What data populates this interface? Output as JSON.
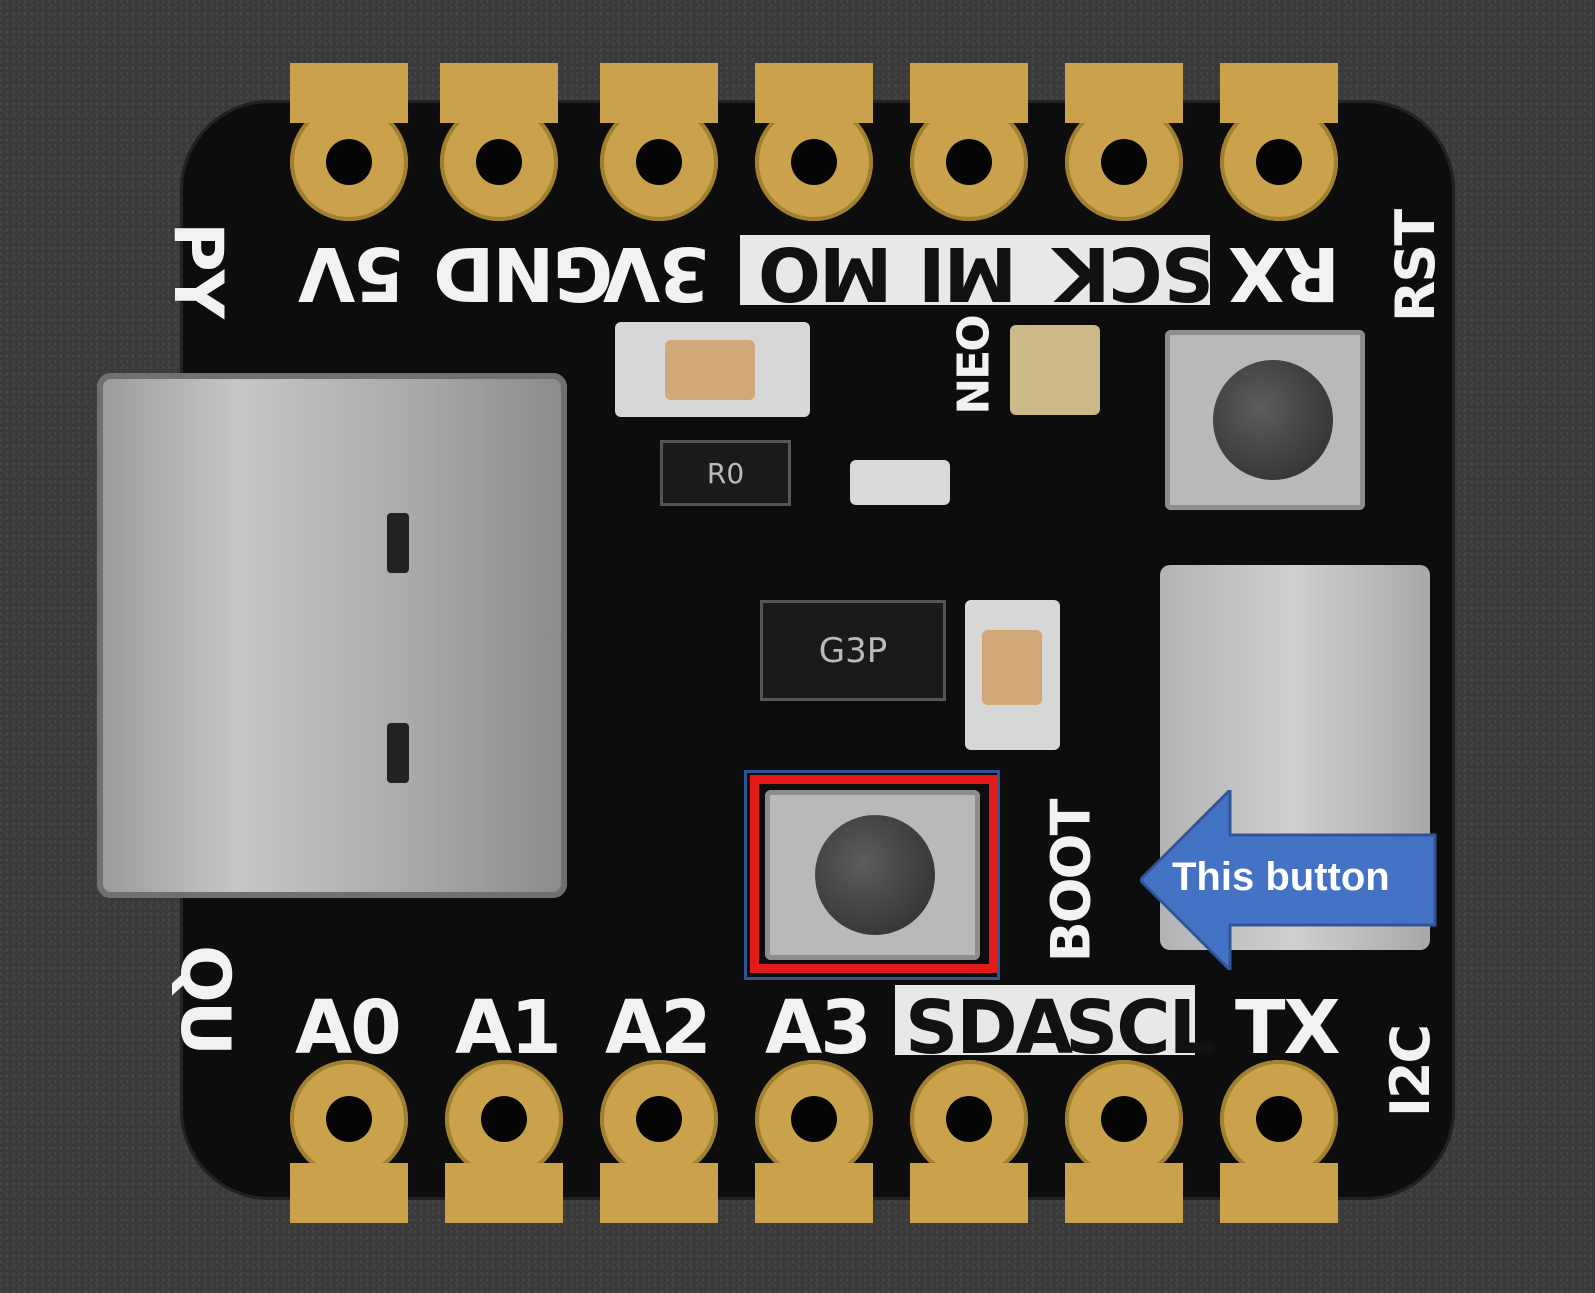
{
  "board": {
    "top_pins": [
      "5V",
      "GND",
      "3V",
      "MO",
      "MI",
      "SCK",
      "RX"
    ],
    "bottom_pins": [
      "A0",
      "A1",
      "A2",
      "A3",
      "SDA",
      "SCL",
      "TX"
    ],
    "side_labels": {
      "left_top": "PY",
      "left_bottom": "QU",
      "right_top": "RST",
      "right_bottom": "I2C",
      "neo": "NEO",
      "boot": "BOOT"
    },
    "chip_marking": "G3P",
    "diode_marking": "R0"
  },
  "annotation": {
    "callout_text": "This button",
    "highlight_color": "#e31a1a",
    "arrow_color": "#4472c4",
    "outline_color": "#2f5596"
  }
}
